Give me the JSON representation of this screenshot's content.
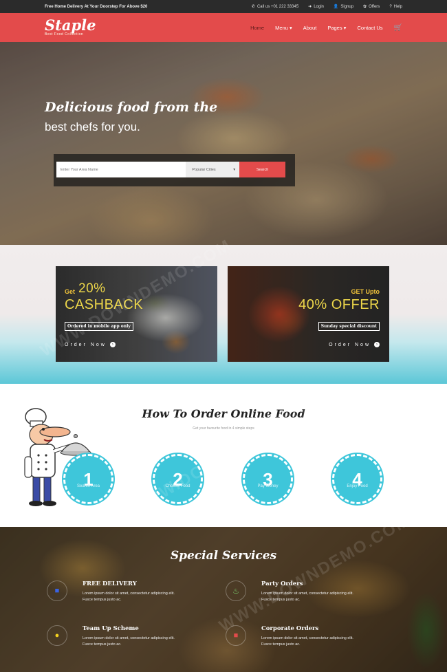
{
  "topbar": {
    "promo": "Free Home Delivery At Your Doorstep For Above $20",
    "call": "Call us +01 222 33345",
    "login": "Login",
    "signup": "Signup",
    "offers": "Offers",
    "help": "Help"
  },
  "brand": {
    "name": "Staple",
    "tagline": "Best Food Collection"
  },
  "nav": {
    "home": "Home",
    "menu": "Menu ▾",
    "about": "About",
    "pages": "Pages ▾",
    "contact": "Contact Us"
  },
  "hero": {
    "title": "Delicious food from the",
    "subtitle": "best chefs for you.",
    "search_placeholder": "Enter Your Area Name",
    "select_value": "Popular Cities",
    "search_button": "Search"
  },
  "offers": [
    {
      "get": "Get",
      "amount": "20%",
      "word": "CASHBACK",
      "note": "Ordered in mobile app only",
      "cta": "Order Now"
    },
    {
      "get": "GET Upto",
      "amount": "40% OFFER",
      "note": "Sunday special discount",
      "cta": "Order Now"
    }
  ],
  "how": {
    "title": "How To Order Online Food",
    "subtitle": "Get your favourite food in 4 simple steps",
    "steps": [
      {
        "num": "1",
        "label": "Search Area"
      },
      {
        "num": "2",
        "label": "Choose Food"
      },
      {
        "num": "3",
        "label": "Pay Money"
      },
      {
        "num": "4",
        "label": "Enjoy Food"
      }
    ]
  },
  "services": {
    "title": "Special Services",
    "items": [
      {
        "title": "FREE DELIVERY",
        "text": "Lorem ipsum dolor sit amet, consectetur adipiscing elit. Fusce tempus justo ac."
      },
      {
        "title": "Party Orders",
        "text": "Lorem ipsum dolor sit amet, consectetur adipiscing elit. Fusce tempus justo ac."
      },
      {
        "title": "Team Up Scheme",
        "text": "Lorem ipsum dolor sit amet, consectetur adipiscing elit. Fusce tempus justo ac."
      },
      {
        "title": "Corporate Orders",
        "text": "Lorem ipsum dolor sit amet, consectetur adipiscing elit. Fusce tempus justo ac."
      }
    ]
  },
  "watermark": "WWW.DOWNDEMO.COM",
  "colors": {
    "brand_red": "#e34b4b",
    "accent_cyan": "#3ec6da",
    "offer_yellow": "#ecd64a"
  }
}
